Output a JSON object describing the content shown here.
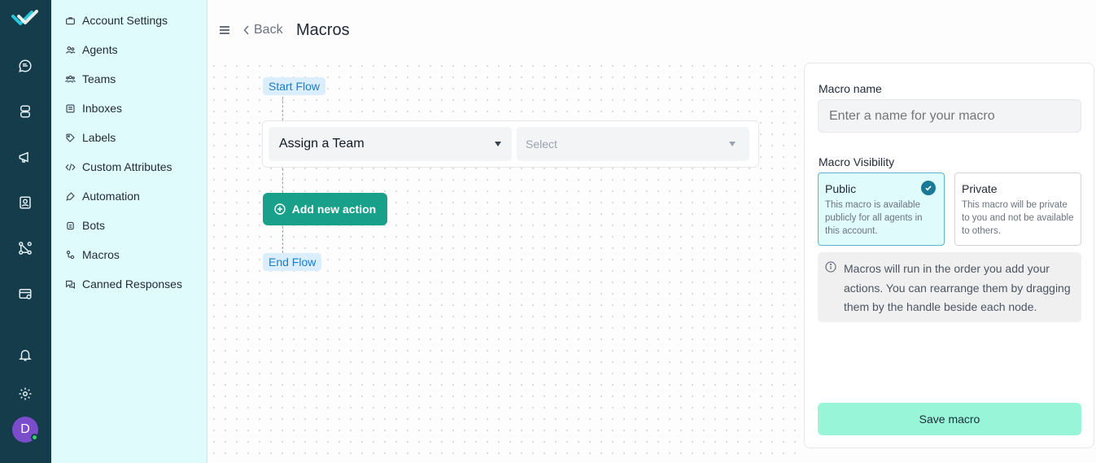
{
  "rail": {
    "icons": [
      "logo-icon",
      "chat-icon",
      "inbox-stack-icon",
      "megaphone-icon",
      "contacts-icon",
      "flow-icon",
      "wallet-icon",
      "bell-icon",
      "gear-icon"
    ],
    "avatar_initial": "D",
    "avatar_color": "#7c4dcb",
    "online_color": "#3ccf72"
  },
  "sidebar": {
    "items": [
      {
        "label": "Account Settings",
        "icon": "briefcase-icon"
      },
      {
        "label": "Agents",
        "icon": "people-icon"
      },
      {
        "label": "Teams",
        "icon": "team-icon"
      },
      {
        "label": "Inboxes",
        "icon": "inbox-icon"
      },
      {
        "label": "Labels",
        "icon": "tag-icon"
      },
      {
        "label": "Custom Attributes",
        "icon": "code-icon"
      },
      {
        "label": "Automation",
        "icon": "automation-icon"
      },
      {
        "label": "Bots",
        "icon": "bot-icon"
      },
      {
        "label": "Macros",
        "icon": "macro-icon"
      },
      {
        "label": "Canned Responses",
        "icon": "chat-bubbles-icon"
      }
    ]
  },
  "header": {
    "back_label": "Back",
    "title": "Macros"
  },
  "flow": {
    "start_label": "Start Flow",
    "end_label": "End Flow",
    "action": {
      "type_value": "Assign a Team",
      "target_placeholder": "Select"
    },
    "add_action_label": "Add new action"
  },
  "panel": {
    "name_label": "Macro name",
    "name_placeholder": "Enter a name for your macro",
    "visibility_label": "Macro Visibility",
    "public": {
      "title": "Public",
      "description": "This macro is available publicly for all agents in this account.",
      "selected": true
    },
    "private": {
      "title": "Private",
      "description": "This macro will be private to you and not be available to others.",
      "selected": false
    },
    "info_text": "Macros will run in the order you add your actions. You can rearrange them by dragging them by the handle beside each node.",
    "save_label": "Save macro"
  },
  "colors": {
    "rail_bg": "#143c4a",
    "sidebar_bg": "#e0fbfc",
    "primary": "#19a08a",
    "save_bg": "#98f5d8",
    "pill_bg": "#dbeefe",
    "pill_text": "#1d7bc6"
  }
}
